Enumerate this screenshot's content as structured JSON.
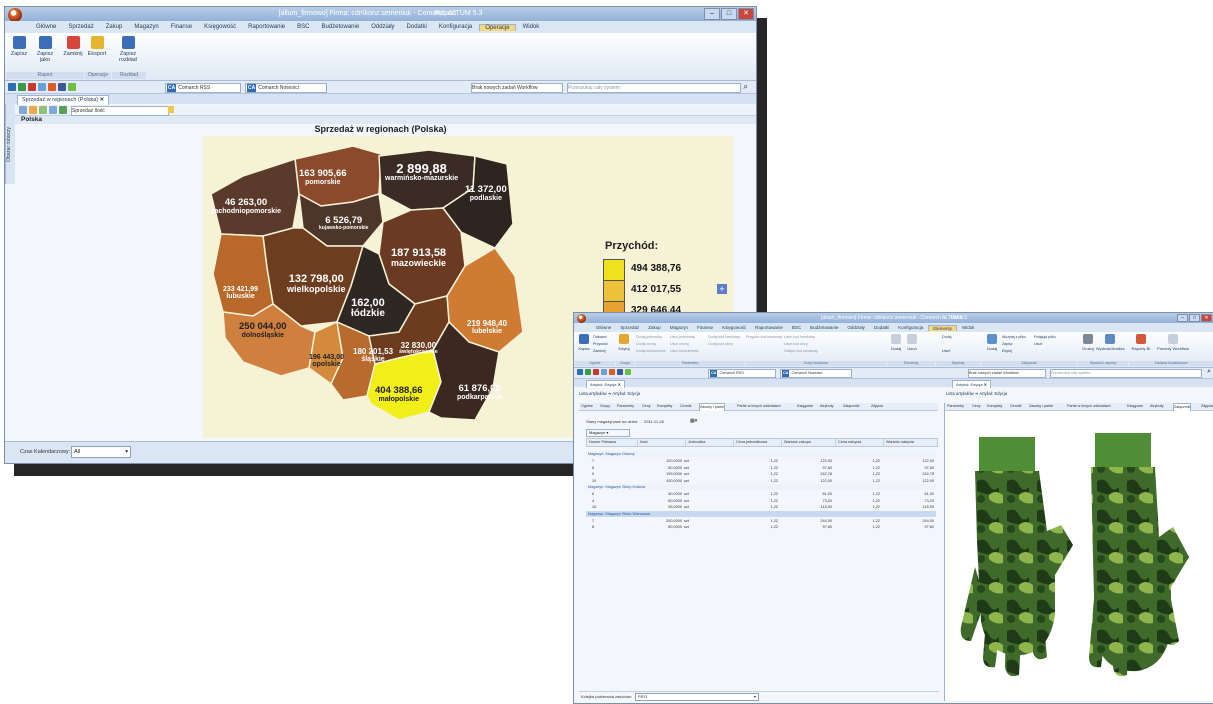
{
  "win1": {
    "title": "[allum_firmowo] Firma: cdn\\konz.semeniuk - Comarch ALTUM 5.3",
    "context_title": "Raport",
    "tabs": [
      "Główne",
      "Sprzedaż",
      "Zakup",
      "Magazyn",
      "Finanse",
      "Księgowość",
      "Raportowanie",
      "BSC",
      "Budżetowanie",
      "Oddziały",
      "Dodatki",
      "Konfiguracja",
      "Operacje",
      "Widok"
    ],
    "active_tab": "Operacje",
    "ribbon": {
      "save": "Zapisz",
      "save_as": "Zapisz jako",
      "close": "Zamknij",
      "export": "Eksport",
      "save_layout": "Zapisz rozkład",
      "group_report": "Raport",
      "group_ops": "Operacje",
      "group_layout": "Rozkład"
    },
    "rss": "Comarch RSS",
    "news": "Comarch Nowości",
    "workflow": "Brak nowych zadań Workflow",
    "search_placeholder": "Przeszukaj cały system",
    "doc_tab": "Sprzedaż w regionach (Polska)",
    "sidebar": "Obszar roboczy",
    "toolbar_combo": "Sprzedaż Ilość",
    "panel_label": "Polska",
    "map": {
      "title": "Sprzedaż w regionach (Polska)",
      "regions": [
        {
          "value": "163 905,66",
          "name": "pomorskie"
        },
        {
          "value": "2 899,88",
          "name": "warmińsko-mazurskie"
        },
        {
          "value": "46 263,00",
          "name": "zachodniopomorskie"
        },
        {
          "value": "11 372,00",
          "name": "podlaskie"
        },
        {
          "value": "6 526,79",
          "name": "kujawsko-pomorskie"
        },
        {
          "value": "187 913,58",
          "name": "mazowieckie"
        },
        {
          "value": "132 798,00",
          "name": "wielkopolskie"
        },
        {
          "value": "233 421,99",
          "name": "lubuskie"
        },
        {
          "value": "162,00",
          "name": "łódzkie"
        },
        {
          "value": "219 948,40",
          "name": "lubelskie"
        },
        {
          "value": "250 044,00",
          "name": "dolnośląskie"
        },
        {
          "value": "196 443,00",
          "name": "opolskie"
        },
        {
          "value": "180 201,53",
          "name": "śląskie"
        },
        {
          "value": "32 830,00",
          "name": "świętokrzyskie"
        },
        {
          "value": "404 388,66",
          "name": "małopolskie"
        },
        {
          "value": "61 876,00",
          "name": "podkarpackie"
        }
      ],
      "legend_title": "Przychód:",
      "legend_values": [
        "494 388,76",
        "412 017,55",
        "329 646,44"
      ],
      "legend_colors": [
        "#f0e21a",
        "#efc13a",
        "#e8a232"
      ]
    },
    "status_label": "Czas Kalendarzowy:",
    "status_value": "All"
  },
  "win2": {
    "title": "[altum_firmowo] Firma: cdn\\konz.semeniuk - Comarch ALTUM 5.3",
    "context_title": "Towar",
    "tabs": [
      "Główne",
      "Sprzedaż",
      "Zakup",
      "Magazyn",
      "Finanse",
      "Księgowość",
      "Raportowanie",
      "BSC",
      "Budżetowanie",
      "Oddziały",
      "Dodatki",
      "Konfiguracja",
      "Elementy",
      "Widok"
    ],
    "active_tab": "Elementy",
    "ribbon": {
      "save": "Zapisz",
      "refresh": "Odśwież",
      "restore": "Przywróć",
      "close": "Zamknij",
      "edit": "Edytuj",
      "group_general": "Ogólne",
      "group_group": "Grupa",
      "group_params": "Parametry",
      "group_codes": "Kody kreskowe",
      "group_elements": "Elementy",
      "group_attr": "Atrybuty",
      "group_attach": "Załączniki",
      "group_prints": "Wydruki i raporty",
      "group_tasks": "Zadania kontekstowe",
      "add": "Dodaj",
      "delete": "Usuń",
      "load_file": "Wczytaj z pliku",
      "preview": "Podgląd pliku",
      "save2": "Zapisz",
      "edit2": "Edytuj",
      "print": "Drukuj",
      "print_analytics": "Wydruki/Analiza",
      "reports_bi": "Raporty BI",
      "workflow_proc": "Procesy Workflow",
      "small": [
        "Dodaj jednostkę",
        "Usuń jednostkę",
        "Dodaj cechę",
        "Usuń cechę",
        "Dodaj kontrahenta",
        "Usuń kontrahenta",
        "Dodaj kod kreskowy",
        "Usuń kod kreskowy",
        "Dodaj kod obcy",
        "Usuń kod obcy",
        "Przypisz kod kreskowy",
        "Odłącz kod kreskowy"
      ]
    },
    "rss": "Comarch RSS",
    "news": "Comarch Nowości",
    "workflow": "Brak nowych zadań Workflow",
    "search_placeholder": "Przeszukaj cały system",
    "left_tab": "Artykuł: Edycja",
    "right_tab": "Artykuł: Edycja",
    "breadcrumb_root": "Lista artykułów",
    "breadcrumb_leaf": "Artykuł: Edycja",
    "subtabs": [
      "Ogólne",
      "Grupy",
      "Parametry",
      "Ceny",
      "Komplety",
      "Cennik",
      "Zasoby i partie",
      "Partie w innych oddziałach",
      "Księgowe",
      "Atrybuty",
      "Załączniki",
      "Zdjęcia"
    ],
    "right_subtabs": [
      "Parametry",
      "Ceny",
      "Komplety",
      "Cennik",
      "Zasoby i partie",
      "Partie w innych oddziałach",
      "Księgowe",
      "Atrybuty",
      "Załączniki",
      "Zdjęcia"
    ],
    "date_label": "Stany magazynowe na dzień:",
    "date_value": "2011-11-25",
    "warehouse_btn": "Magazyn",
    "columns": [
      "Numer Pełnawa",
      "Ilość",
      "Jednostka",
      "Cena jednostkowa",
      "Wartość zakupu",
      "Cena nabycia",
      "Wartość nabycia"
    ],
    "groups": [
      {
        "name": "Magazyn: Magazyn Główny",
        "rows": [
          [
            "7",
            "100,0000",
            "szt",
            "1,22",
            "122,00",
            "1,22",
            "122,00"
          ],
          [
            "8",
            "80,0000",
            "szt",
            "1,22",
            "97,60",
            "1,22",
            "97,60"
          ],
          [
            "9",
            "199,0000",
            "szt",
            "1,22",
            "242,78",
            "1,22",
            "242,78"
          ],
          [
            "10",
            "100,0000",
            "szt",
            "1,22",
            "122,00",
            "1,22",
            "122,00"
          ]
        ]
      },
      {
        "name": "Magazyn: Magazyn Sklep Kraków",
        "rows": [
          [
            "6",
            "50,0000",
            "szt",
            "1,22",
            "61,00",
            "1,22",
            "61,00"
          ],
          [
            "4",
            "60,0000",
            "szt",
            "1,22",
            "73,20",
            "1,22",
            "73,20"
          ],
          [
            "10",
            "95,0000",
            "szt",
            "1,22",
            "115,90",
            "1,22",
            "115,90"
          ]
        ]
      },
      {
        "name": "Magazyn: Magazyn Sklep Warszawa",
        "rows": [
          [
            "7",
            "200,0000",
            "szt",
            "1,22",
            "244,00",
            "1,22",
            "244,00"
          ],
          [
            "8",
            "80,0000",
            "szt",
            "1,22",
            "97,60",
            "1,22",
            "97,60"
          ]
        ]
      }
    ],
    "footer_label": "Kolejka pobierania zasobów:",
    "footer_value": "FIFO"
  }
}
